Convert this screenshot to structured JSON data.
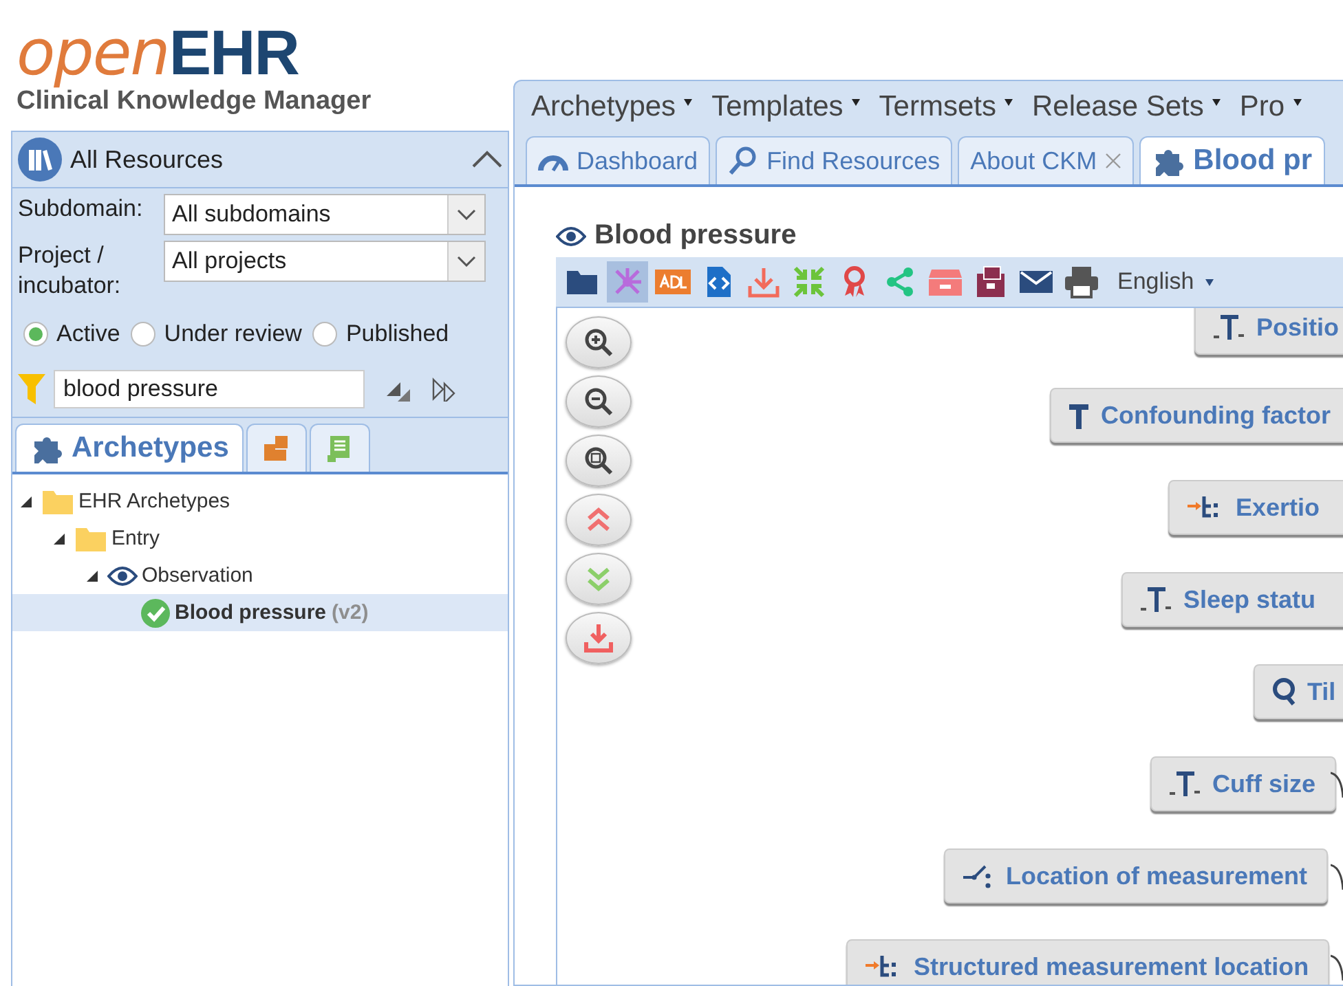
{
  "logo": {
    "prefix": "open",
    "name": "EHR",
    "subtitle": "Clinical Knowledge Manager"
  },
  "resources_panel": {
    "title": "All Resources",
    "expanded": true,
    "filters": [
      {
        "label": "Subdomain:",
        "value": "All subdomains"
      },
      {
        "label": "Project / incubator:",
        "value": "All projects"
      }
    ],
    "status_options": [
      {
        "label": "Active",
        "selected": true
      },
      {
        "label": "Under review",
        "selected": false
      },
      {
        "label": "Published",
        "selected": false
      }
    ],
    "search": {
      "value": "blood pressure"
    },
    "resource_tabs": [
      {
        "label": "Archetypes",
        "selected": true
      },
      {
        "selected": false
      },
      {
        "selected": false
      }
    ],
    "tree": [
      {
        "label": "EHR Archetypes",
        "kind": "folder",
        "expanded": true,
        "selected": false,
        "children": [
          {
            "label": "Entry",
            "kind": "folder",
            "expanded": true,
            "selected": false,
            "children": [
              {
                "label": "Observation",
                "kind": "eye",
                "expanded": true,
                "selected": false,
                "children": [
                  {
                    "label": "Blood pressure",
                    "version": "(v2)",
                    "kind": "published",
                    "selected": true
                  }
                ]
              }
            ]
          }
        ]
      }
    ]
  },
  "menu": [
    {
      "label": "Archetypes"
    },
    {
      "label": "Templates"
    },
    {
      "label": "Termsets"
    },
    {
      "label": "Release Sets"
    },
    {
      "label": "Pro"
    }
  ],
  "tabs": [
    {
      "label": "Dashboard",
      "kind": "dashboard",
      "selected": false,
      "closable": false
    },
    {
      "label": "Find Resources",
      "kind": "search",
      "selected": false,
      "closable": false
    },
    {
      "label": "About CKM",
      "kind": "plain",
      "selected": false,
      "closable": true
    },
    {
      "label": "Blood pr",
      "kind": "archetype",
      "selected": true,
      "closable": false
    }
  ],
  "archetype": {
    "title": "Blood pressure",
    "language": "English",
    "toolbar": [
      {
        "kind": "folder",
        "selected": false
      },
      {
        "kind": "mindmap",
        "selected": true
      },
      {
        "kind": "adl",
        "selected": false
      },
      {
        "kind": "code",
        "selected": false
      },
      {
        "kind": "download",
        "selected": false
      },
      {
        "kind": "compress",
        "selected": false
      },
      {
        "kind": "ribbon",
        "selected": false
      },
      {
        "kind": "share",
        "selected": false
      },
      {
        "kind": "archive",
        "selected": false
      },
      {
        "kind": "binder",
        "selected": false
      },
      {
        "kind": "mail",
        "selected": false
      },
      {
        "kind": "print",
        "selected": false
      }
    ],
    "nodes": [
      {
        "label": "Positio",
        "kind": "coded_text"
      },
      {
        "label": "Confounding factor",
        "kind": "text"
      },
      {
        "label": "Exertio",
        "kind": "cluster"
      },
      {
        "label": "Sleep statu",
        "kind": "coded_text"
      },
      {
        "label": "Til",
        "kind": "quantity"
      },
      {
        "label": "Cuff size",
        "kind": "coded_text"
      },
      {
        "label": "Location of measurement",
        "kind": "choice"
      },
      {
        "label": "Structured measurement location",
        "kind": "cluster"
      }
    ]
  }
}
